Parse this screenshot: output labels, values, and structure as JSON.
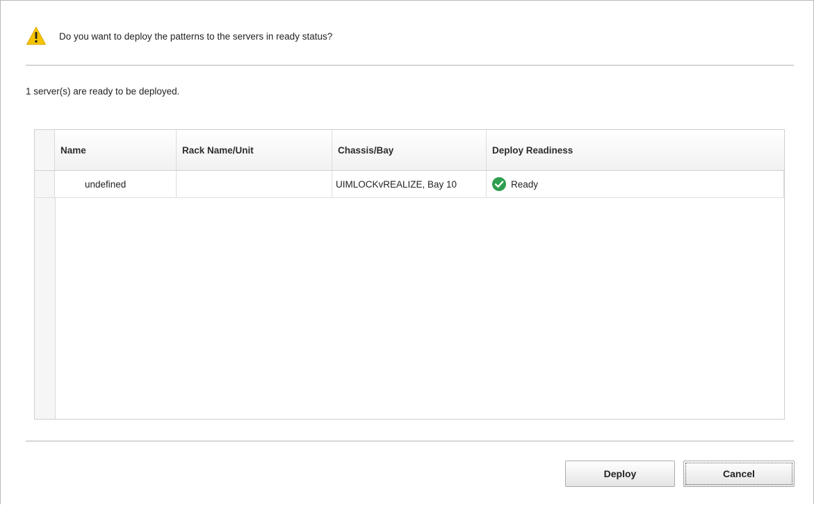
{
  "dialog": {
    "question": "Do you want to deploy the patterns to the servers in ready status?",
    "summary": "1 server(s) are ready to be deployed."
  },
  "table": {
    "columns": [
      "Name",
      "Rack Name/Unit",
      "Chassis/Bay",
      "Deploy Readiness"
    ],
    "rows": [
      {
        "name": "undefined",
        "rack": "",
        "chassis": "UIMLOCKvREALIZE, Bay 10",
        "readiness": "Ready",
        "readiness_icon": "check-circle-icon"
      }
    ]
  },
  "buttons": {
    "deploy": "Deploy",
    "cancel": "Cancel"
  },
  "colors": {
    "warning": "#f5c400",
    "ready": "#2e9e4f"
  }
}
